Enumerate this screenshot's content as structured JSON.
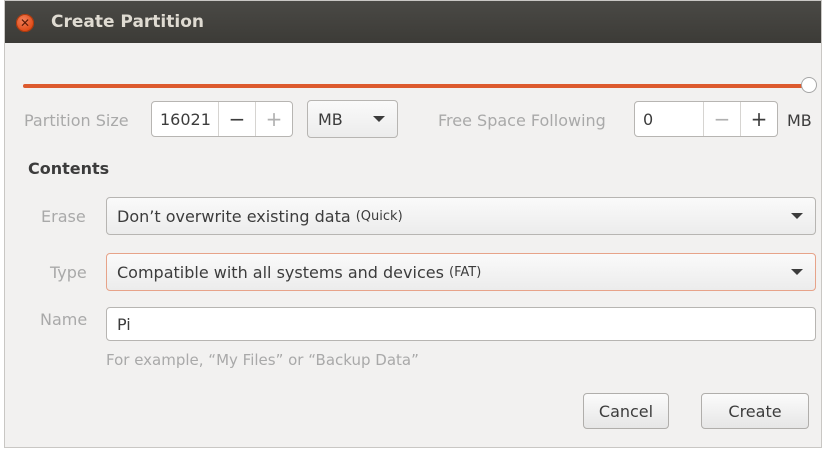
{
  "window": {
    "title": "Create Partition"
  },
  "slider": {
    "value_fraction": 1.0
  },
  "size": {
    "label": "Partition Size",
    "value": "16021",
    "minus": "−",
    "plus": "+",
    "unit": "MB"
  },
  "free_space": {
    "label": "Free Space Following",
    "value": "0",
    "minus": "−",
    "plus": "+",
    "unit": "MB"
  },
  "contents": {
    "heading": "Contents",
    "erase_label": "Erase",
    "erase_value": "Don’t overwrite existing data",
    "erase_note": "(Quick)",
    "type_label": "Type",
    "type_value": "Compatible with all systems and devices",
    "type_note": "(FAT)",
    "name_label": "Name",
    "name_value": "Pi",
    "name_hint": "For example, “My Files” or “Backup Data”"
  },
  "buttons": {
    "cancel": "Cancel",
    "create": "Create"
  },
  "colors": {
    "accent": "#dd5a2e",
    "titlebar": "#3c3b37"
  }
}
